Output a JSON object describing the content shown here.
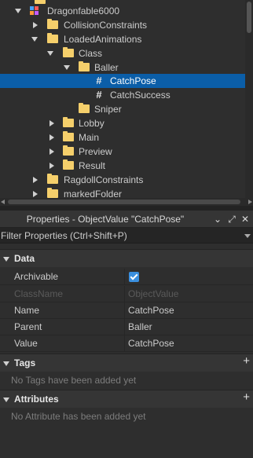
{
  "explorer": {
    "rows": [
      {
        "label": "Dragonfable6000",
        "icon": "model-icon"
      },
      {
        "label": "CollisionConstraints",
        "icon": "folder-icon"
      },
      {
        "label": "LoadedAnimations",
        "icon": "folder-icon"
      },
      {
        "label": "Class",
        "icon": "folder-icon"
      },
      {
        "label": "Baller",
        "icon": "folder-icon"
      },
      {
        "label": "CatchPose",
        "icon": "value-icon",
        "selected": true
      },
      {
        "label": "CatchSuccess",
        "icon": "value-icon"
      },
      {
        "label": "Sniper",
        "icon": "folder-icon"
      },
      {
        "label": "Lobby",
        "icon": "folder-icon"
      },
      {
        "label": "Main",
        "icon": "folder-icon"
      },
      {
        "label": "Preview",
        "icon": "folder-icon"
      },
      {
        "label": "Result",
        "icon": "folder-icon"
      },
      {
        "label": "RagdollConstraints",
        "icon": "folder-icon"
      },
      {
        "label": "markedFolder",
        "icon": "folder-icon"
      }
    ]
  },
  "properties": {
    "title": "Properties - ObjectValue \"CatchPose\"",
    "filter_placeholder": "Filter Properties (Ctrl+Shift+P)",
    "sections": {
      "data": {
        "label": "Data",
        "rows": [
          {
            "name": "Archivable",
            "value": "",
            "checked": true
          },
          {
            "name": "ClassName",
            "value": "ObjectValue",
            "disabled": true
          },
          {
            "name": "Name",
            "value": "CatchPose"
          },
          {
            "name": "Parent",
            "value": "Baller"
          },
          {
            "name": "Value",
            "value": "CatchPose"
          }
        ]
      },
      "tags": {
        "label": "Tags",
        "empty_text": "No Tags have been added yet",
        "add_label": "+"
      },
      "attributes": {
        "label": "Attributes",
        "empty_text": "No Attribute has been added yet",
        "add_label": "+"
      }
    },
    "header_buttons": {
      "collapse": "⌄",
      "popout": "⤢",
      "close": "✕"
    }
  },
  "colors": {
    "background": "#2e2e2e",
    "selection": "#0b5ea8",
    "folder": "#f5cf6b",
    "checkbox": "#3a8fde"
  }
}
